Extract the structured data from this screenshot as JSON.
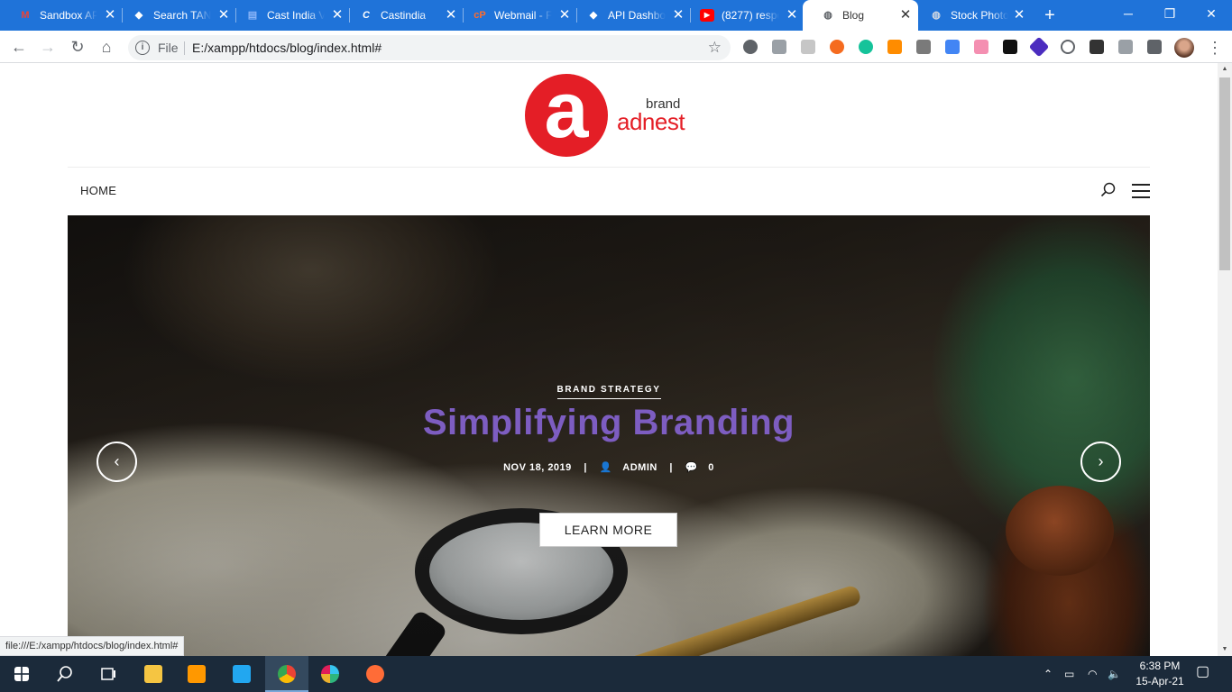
{
  "browser": {
    "tabs": [
      {
        "label": "Sandbox AP",
        "icon": "gmail-icon",
        "color": "#ea4335",
        "active": false
      },
      {
        "label": "Search TAN",
        "icon": "api-icon",
        "color": "#ffffff",
        "active": false
      },
      {
        "label": "Cast India V",
        "icon": "docs-icon",
        "color": "#4285f4",
        "active": false
      },
      {
        "label": "Castindia",
        "icon": "cast-icon",
        "color": "#ffffff",
        "active": false
      },
      {
        "label": "Webmail - F",
        "icon": "cpanel-icon",
        "color": "#ff6c2c",
        "active": false
      },
      {
        "label": "API Dashbo",
        "icon": "api-icon",
        "color": "#ffffff",
        "active": false
      },
      {
        "label": "(8277) respo",
        "icon": "youtube-icon",
        "color": "#ff0000",
        "active": false
      },
      {
        "label": "Blog",
        "icon": "globe-icon",
        "color": "#5f6368",
        "active": true
      },
      {
        "label": "Stock Photo",
        "icon": "globe-icon",
        "color": "#5f6368",
        "active": false
      }
    ],
    "new_tab": "+",
    "window_controls": {
      "minimize": "─",
      "restore": "❐",
      "close": "✕"
    },
    "omnibox": {
      "scheme_label": "File",
      "url": "E:/xampp/htdocs/blog/index.html#"
    },
    "status_url": "file:///E:/xampp/htdocs/blog/index.html#"
  },
  "site": {
    "logo": {
      "brand": "brand",
      "name": "adnest",
      "accent": "#e41e26"
    },
    "nav": {
      "home": "HOME"
    },
    "hero": {
      "category": "BRAND STRATEGY",
      "title": "Simplifying Branding",
      "date": "NOV 18, 2019",
      "author": "ADMIN",
      "comments": "0",
      "button": "LEARN MORE",
      "title_color": "#7d5dc1"
    }
  },
  "taskbar": {
    "apps": [
      "windows-start-icon",
      "search-icon",
      "task-view-icon",
      "file-explorer-icon",
      "sublime-icon",
      "vscode-icon",
      "chrome-icon",
      "slack-icon",
      "postman-icon"
    ],
    "clock_time": "6:38 PM",
    "clock_date": "15-Apr-21"
  }
}
